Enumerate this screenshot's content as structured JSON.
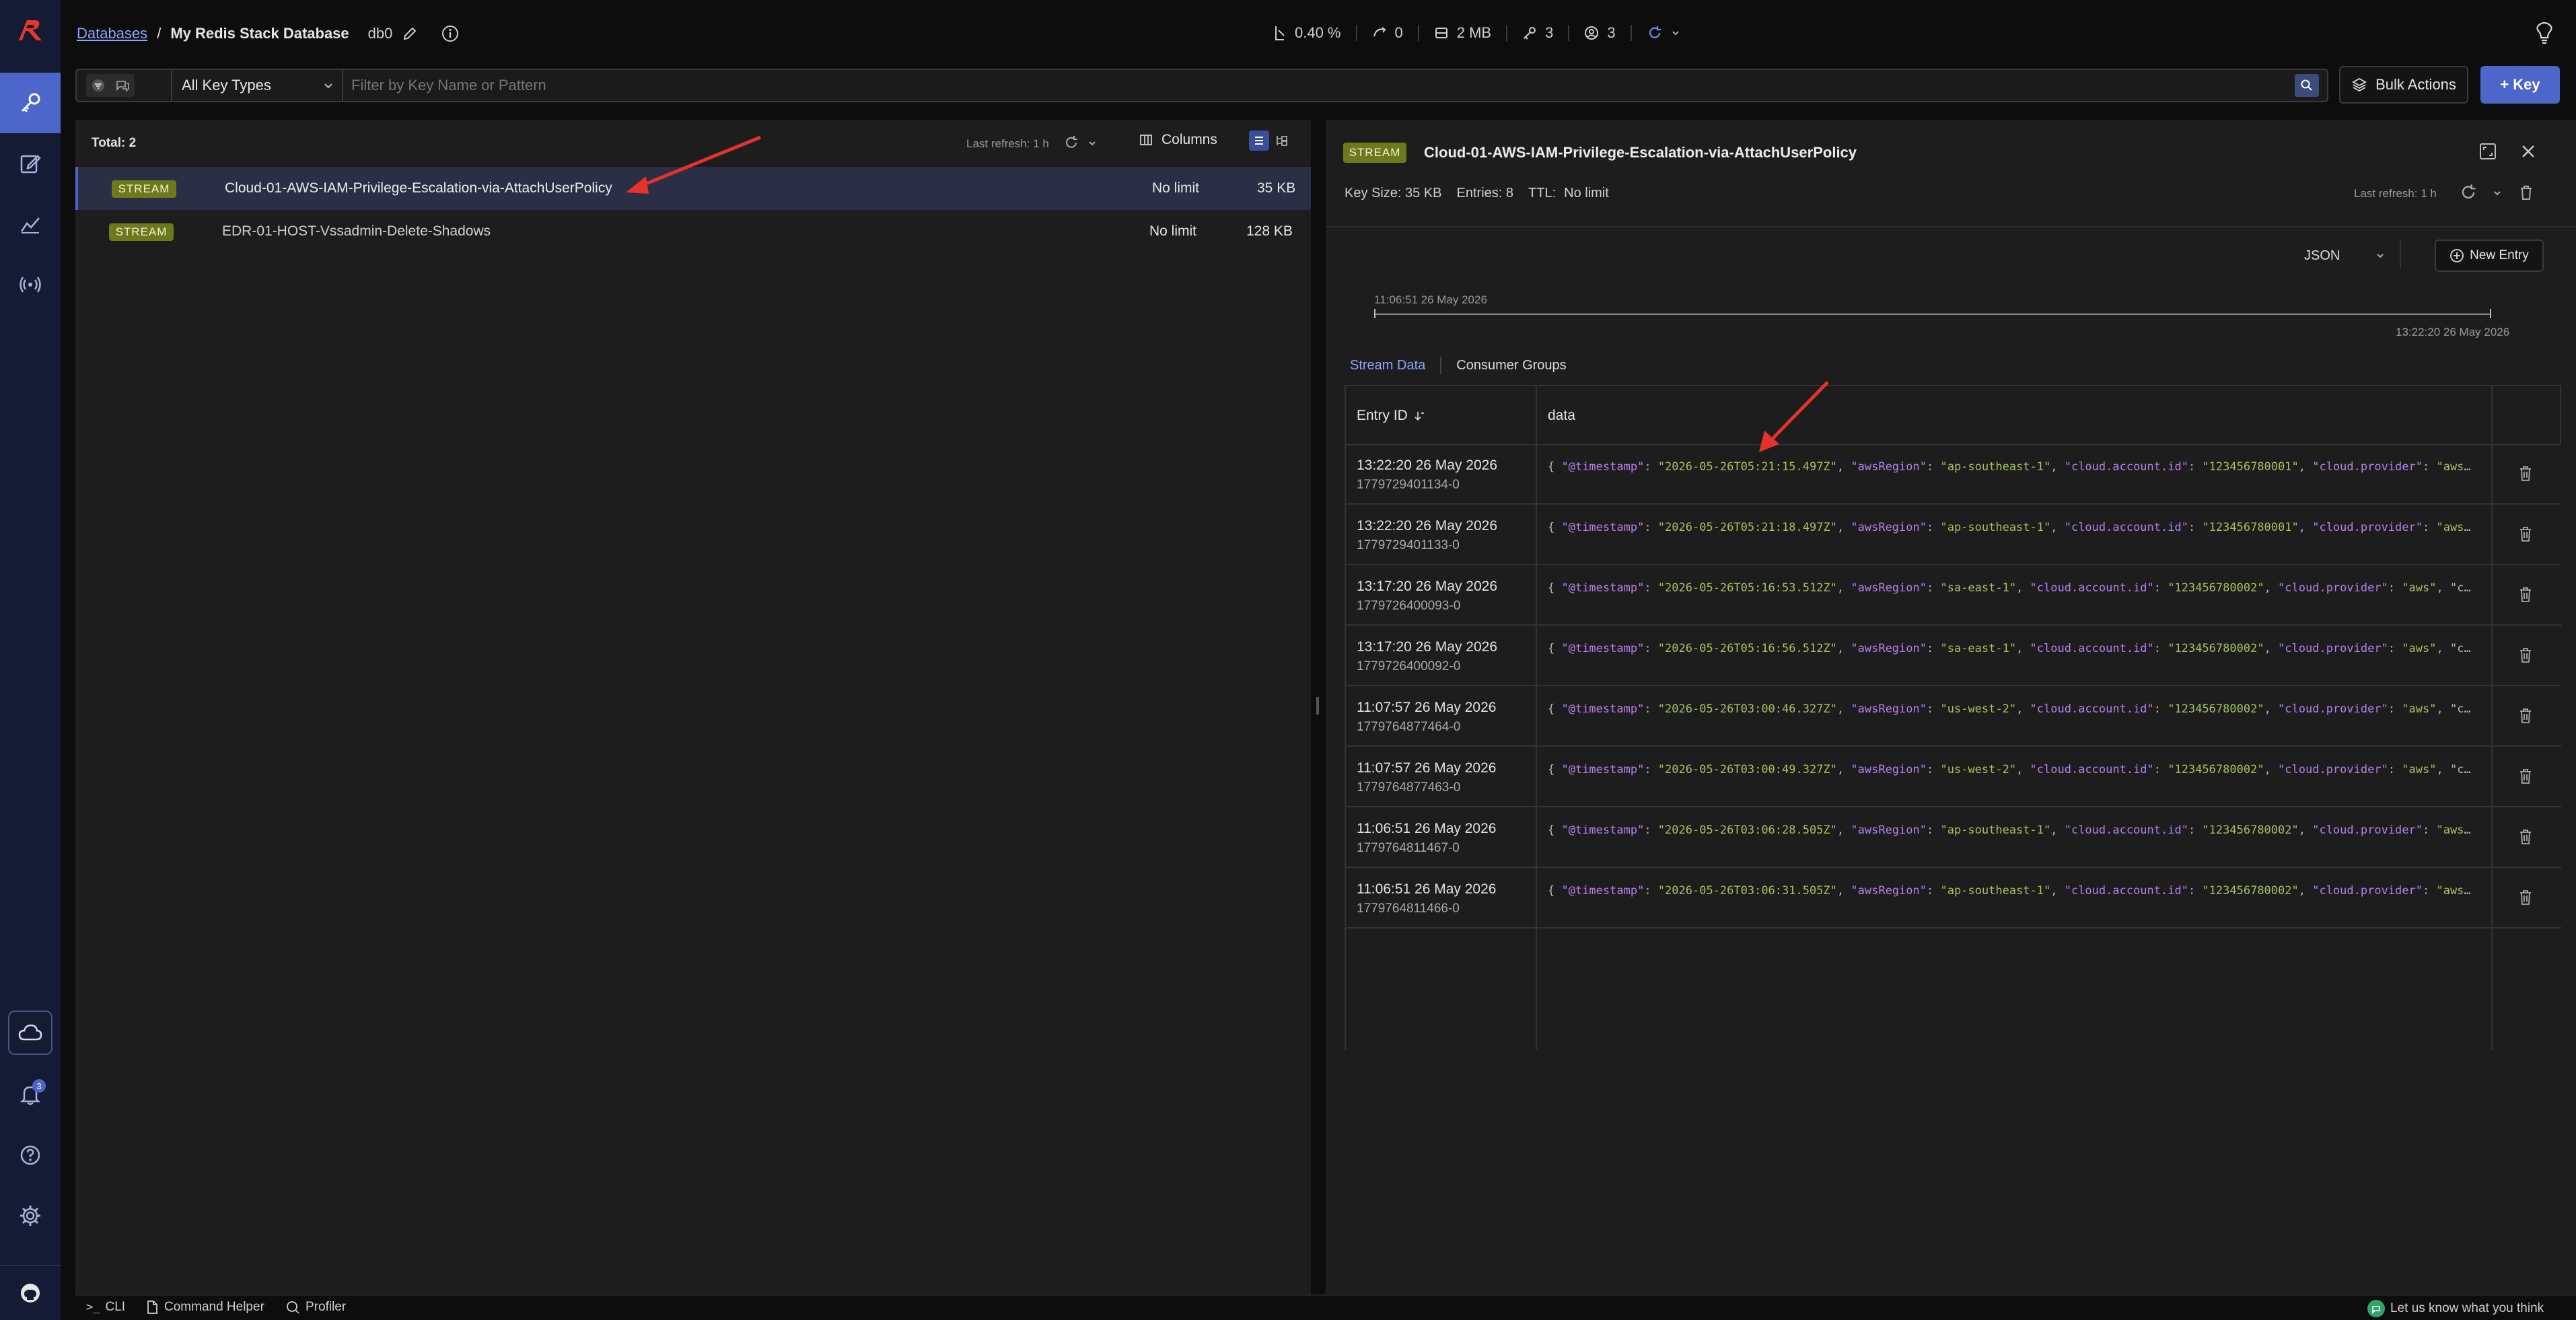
{
  "header": {
    "breadcrumb_root": "Databases",
    "breadcrumb_sep": "/",
    "database_name": "My Redis Stack Database",
    "db_index": "db0",
    "stats": {
      "cpu": "0.40 %",
      "ops": "0",
      "memory": "2 MB",
      "keys": "3",
      "clients": "3"
    }
  },
  "filter": {
    "key_type": "All Key Types",
    "search_placeholder": "Filter by Key Name or Pattern",
    "bulk_actions": "Bulk Actions",
    "add_key": "+ Key"
  },
  "key_list": {
    "total": "Total: 2",
    "last_refresh": "Last refresh: 1 h",
    "columns_label": "Columns",
    "keys": [
      {
        "type": "STREAM",
        "name": "Cloud-01-AWS-IAM-Privilege-Escalation-via-AttachUserPolicy",
        "ttl": "No limit",
        "size": "35 KB"
      },
      {
        "type": "STREAM",
        "name": "EDR-01-HOST-Vssadmin-Delete-Shadows",
        "ttl": "No limit",
        "size": "128 KB"
      }
    ]
  },
  "detail": {
    "type": "STREAM",
    "key_name": "Cloud-01-AWS-IAM-Privilege-Escalation-via-AttachUserPolicy",
    "key_size": "Key Size: 35 KB",
    "entries": "Entries: 8",
    "ttl_label": "TTL:",
    "ttl_value": "No limit",
    "last_refresh": "Last refresh: 1 h",
    "format": "JSON",
    "new_entry": "New Entry",
    "range_start": "11:06:51 26 May 2026",
    "range_end": "13:22:20 26 May 2026",
    "tabs": [
      "Stream Data",
      "Consumer Groups"
    ],
    "col_entry_id": "Entry ID",
    "col_data": "data",
    "rows": [
      {
        "time": "13:22:20 26 May 2026",
        "id": "1779729401134-0",
        "data": "{ \"@timestamp\": \"2026-05-26T05:21:15.497Z\", \"awsRegion\": \"ap-southeast-1\", \"cloud.account.id\": \"123456780001\", \"cloud.provider\": \"aws\", \"..."
      },
      {
        "time": "13:22:20 26 May 2026",
        "id": "1779729401133-0",
        "data": "{ \"@timestamp\": \"2026-05-26T05:21:18.497Z\", \"awsRegion\": \"ap-southeast-1\", \"cloud.account.id\": \"123456780001\", \"cloud.provider\": \"aws\", \"..."
      },
      {
        "time": "13:17:20 26 May 2026",
        "id": "1779726400093-0",
        "data": "{ \"@timestamp\": \"2026-05-26T05:16:53.512Z\", \"awsRegion\": \"sa-east-1\", \"cloud.account.id\": \"123456780002\", \"cloud.provider\": \"aws\", \"cloud..."
      },
      {
        "time": "13:17:20 26 May 2026",
        "id": "1779726400092-0",
        "data": "{ \"@timestamp\": \"2026-05-26T05:16:56.512Z\", \"awsRegion\": \"sa-east-1\", \"cloud.account.id\": \"123456780002\", \"cloud.provider\": \"aws\", \"cloud..."
      },
      {
        "time": "11:07:57 26 May 2026",
        "id": "1779764877464-0",
        "data": "{ \"@timestamp\": \"2026-05-26T03:00:46.327Z\", \"awsRegion\": \"us-west-2\", \"cloud.account.id\": \"123456780002\", \"cloud.provider\": \"aws\", \"cloud..."
      },
      {
        "time": "11:07:57 26 May 2026",
        "id": "1779764877463-0",
        "data": "{ \"@timestamp\": \"2026-05-26T03:00:49.327Z\", \"awsRegion\": \"us-west-2\", \"cloud.account.id\": \"123456780002\", \"cloud.provider\": \"aws\", \"cloud..."
      },
      {
        "time": "11:06:51 26 May 2026",
        "id": "1779764811467-0",
        "data": "{ \"@timestamp\": \"2026-05-26T03:06:28.505Z\", \"awsRegion\": \"ap-southeast-1\", \"cloud.account.id\": \"123456780002\", \"cloud.provider\": \"aws\", \"..."
      },
      {
        "time": "11:06:51 26 May 2026",
        "id": "1779764811466-0",
        "data": "{ \"@timestamp\": \"2026-05-26T03:06:31.505Z\", \"awsRegion\": \"ap-southeast-1\", \"cloud.account.id\": \"123456780002\", \"cloud.provider\": \"aws\", \"..."
      }
    ]
  },
  "footer": {
    "cli": "CLI",
    "command_helper": "Command Helper",
    "profiler": "Profiler",
    "feedback": "Let us know what you think"
  },
  "notifications": {
    "count": "3"
  },
  "colors": {
    "accent": "#4c67c9",
    "stream_badge": "#6c7a1c",
    "json_key": "#b87ff0",
    "json_string": "#a4c25c",
    "annotation_arrow": "#e5322a"
  }
}
